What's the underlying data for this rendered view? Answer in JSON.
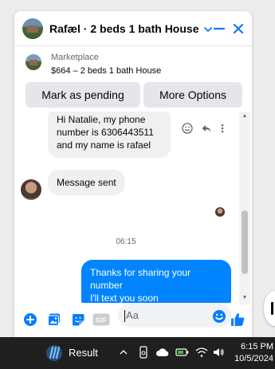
{
  "header": {
    "title": "Rafæl · 2 beds 1 bath House"
  },
  "listing": {
    "marketplace_label": "Marketplace",
    "price_title": "$664 – 2 beds 1 bath House"
  },
  "actions": {
    "mark_pending": "Mark as pending",
    "more_options": "More Options"
  },
  "messages": {
    "incoming_1_line1": "Hi Natalie, my phone",
    "incoming_1_line2": "number is 6306443511",
    "incoming_1_line3": "and my name is rafael",
    "incoming_2": "Message sent",
    "timestamp": "06:15",
    "outgoing_1_line1": "Thanks for sharing your",
    "outgoing_1_line2": "number",
    "outgoing_1_line3": "I'll text you soon"
  },
  "composer": {
    "placeholder": "Aa",
    "gif_label": "GIF"
  },
  "taskbar": {
    "search_label": "Result",
    "time": "6:15 PM",
    "date": "10/5/2024"
  },
  "colors": {
    "accent": "#0084ff",
    "messenger_blue": "#0a7cff"
  },
  "icons": {
    "minimize": "minimize-icon",
    "close": "close-icon",
    "emoji": "emoji-icon",
    "reply": "reply-icon",
    "more": "more-dots-icon",
    "like": "thumbs-up-icon"
  }
}
